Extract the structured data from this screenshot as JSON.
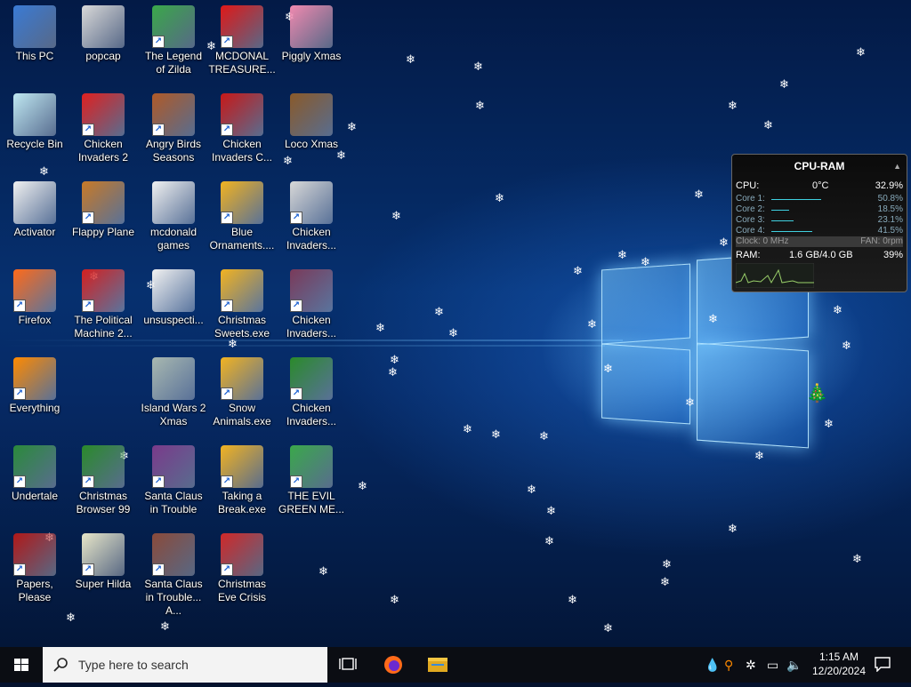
{
  "desktop": {
    "icons": [
      {
        "label": "This PC",
        "col": 0,
        "row": 0,
        "shortcut": false,
        "icon": "computer-icon",
        "color": "#3a7bd5"
      },
      {
        "label": "Recycle Bin",
        "col": 0,
        "row": 1,
        "shortcut": false,
        "icon": "recycle-bin-icon",
        "color": "#bfe8f2"
      },
      {
        "label": "Activator",
        "col": 0,
        "row": 2,
        "shortcut": false,
        "icon": "folder-icon",
        "color": "#f1f1f1"
      },
      {
        "label": "Firefox",
        "col": 0,
        "row": 3,
        "shortcut": true,
        "icon": "firefox-icon",
        "color": "#ff6a1a"
      },
      {
        "label": "Everything",
        "col": 0,
        "row": 4,
        "shortcut": true,
        "icon": "everything-search-icon",
        "color": "#ff8a00"
      },
      {
        "label": "Undertale",
        "col": 0,
        "row": 5,
        "shortcut": true,
        "icon": "undertale-icon",
        "color": "#2a8a3a"
      },
      {
        "label": "Papers, Please",
        "col": 0,
        "row": 6,
        "shortcut": true,
        "icon": "papers-please-icon",
        "color": "#b01818"
      },
      {
        "label": "popcap",
        "col": 1,
        "row": 0,
        "shortcut": false,
        "icon": "popcap-folder-icon",
        "color": "#d9d9d9"
      },
      {
        "label": "Chicken Invaders 2",
        "col": 1,
        "row": 1,
        "shortcut": true,
        "icon": "chicken-icon",
        "color": "#e02020"
      },
      {
        "label": "Flappy Plane",
        "col": 1,
        "row": 2,
        "shortcut": true,
        "icon": "plane-icon",
        "color": "#c87a28"
      },
      {
        "label": "The Political Machine 2...",
        "col": 1,
        "row": 3,
        "shortcut": true,
        "icon": "political-machine-icon",
        "color": "#d42020"
      },
      {
        "label": "Christmas Browser 99",
        "col": 1,
        "row": 5,
        "shortcut": true,
        "icon": "christmas-tree-icon",
        "color": "#2a8a2a"
      },
      {
        "label": "Super Hilda",
        "col": 1,
        "row": 6,
        "shortcut": true,
        "icon": "super-hilda-icon",
        "color": "#e8e6c8"
      },
      {
        "label": "The Legend of Zilda",
        "col": 2,
        "row": 0,
        "shortcut": true,
        "icon": "legend-of-zilda-icon",
        "color": "#3aa84a"
      },
      {
        "label": "Angry Birds Seasons",
        "col": 2,
        "row": 1,
        "shortcut": true,
        "icon": "angry-birds-icon",
        "color": "#b05a28"
      },
      {
        "label": "mcdonald games",
        "col": 2,
        "row": 2,
        "shortcut": false,
        "icon": "folder-icon",
        "color": "#f1f1f1"
      },
      {
        "label": "unsuspecti...",
        "col": 2,
        "row": 3,
        "shortcut": false,
        "icon": "folder-icon",
        "color": "#f1f1f1"
      },
      {
        "label": "Island Wars 2 Xmas",
        "col": 2,
        "row": 4,
        "shortcut": false,
        "icon": "island-wars-icon",
        "color": "#a8b8b0"
      },
      {
        "label": "Santa Claus in Trouble",
        "col": 2,
        "row": 5,
        "shortcut": true,
        "icon": "santa-icon",
        "color": "#7a3a8a"
      },
      {
        "label": "Santa Claus in Trouble... A...",
        "col": 2,
        "row": 6,
        "shortcut": true,
        "icon": "santa-icon",
        "color": "#8a4a3a"
      },
      {
        "label": "MCDONAL TREASURE...",
        "col": 3,
        "row": 0,
        "shortcut": true,
        "icon": "mcdonalds-icon",
        "color": "#e01818"
      },
      {
        "label": "Chicken Invaders C...",
        "col": 3,
        "row": 1,
        "shortcut": true,
        "icon": "snowman-chicken-icon",
        "color": "#c81818"
      },
      {
        "label": "Blue Ornaments....",
        "col": 3,
        "row": 2,
        "shortcut": true,
        "icon": "puzzle-icon",
        "color": "#f2b321"
      },
      {
        "label": "Christmas Sweets.exe",
        "col": 3,
        "row": 3,
        "shortcut": true,
        "icon": "puzzle-icon",
        "color": "#f2b321"
      },
      {
        "label": "Snow Animals.exe",
        "col": 3,
        "row": 4,
        "shortcut": true,
        "icon": "puzzle-icon",
        "color": "#f2b321"
      },
      {
        "label": "Taking a Break.exe",
        "col": 3,
        "row": 5,
        "shortcut": true,
        "icon": "puzzle-icon",
        "color": "#f2b321"
      },
      {
        "label": "Christmas Eve Crisis",
        "col": 3,
        "row": 6,
        "shortcut": true,
        "icon": "santa-icon",
        "color": "#d02828"
      },
      {
        "label": "Piggly Xmas",
        "col": 4,
        "row": 0,
        "shortcut": false,
        "icon": "pig-icon",
        "color": "#f08ab0"
      },
      {
        "label": "Loco Xmas",
        "col": 4,
        "row": 1,
        "shortcut": false,
        "icon": "teddy-bear-icon",
        "color": "#8a5a2a"
      },
      {
        "label": "Chicken Invaders...",
        "col": 4,
        "row": 2,
        "shortcut": true,
        "icon": "chicken-icon",
        "color": "#d8d8d8"
      },
      {
        "label": "Chicken Invaders...",
        "col": 4,
        "row": 3,
        "shortcut": true,
        "icon": "chicken-icon",
        "color": "#7a3a5a"
      },
      {
        "label": "Chicken Invaders...",
        "col": 4,
        "row": 4,
        "shortcut": true,
        "icon": "chicken-icon",
        "color": "#2a8a2a"
      },
      {
        "label": "THE EVIL GREEN ME...",
        "col": 4,
        "row": 5,
        "shortcut": true,
        "icon": "messenger-icon",
        "color": "#3aa84a"
      }
    ]
  },
  "gadget": {
    "title": "CPU-RAM",
    "cpu_label": "CPU:",
    "cpu_temp": "0°C",
    "cpu_total": "32.9%",
    "cores": [
      {
        "label": "Core 1:",
        "value": "50.8%",
        "fraction": 0.508
      },
      {
        "label": "Core 2:",
        "value": "18.5%",
        "fraction": 0.185
      },
      {
        "label": "Core 3:",
        "value": "23.1%",
        "fraction": 0.231
      },
      {
        "label": "Core 4:",
        "value": "41.5%",
        "fraction": 0.415
      }
    ],
    "clock": "Clock: 0 MHz",
    "fan": "FAN: 0rpm",
    "ram_label": "RAM:",
    "ram_value": "1.6 GB/4.0 GB",
    "ram_percent": "39%",
    "accent": "#3fd0e0"
  },
  "taskbar": {
    "search_placeholder": "Type here to search",
    "time": "1:15 AM",
    "date": "12/20/2024"
  }
}
